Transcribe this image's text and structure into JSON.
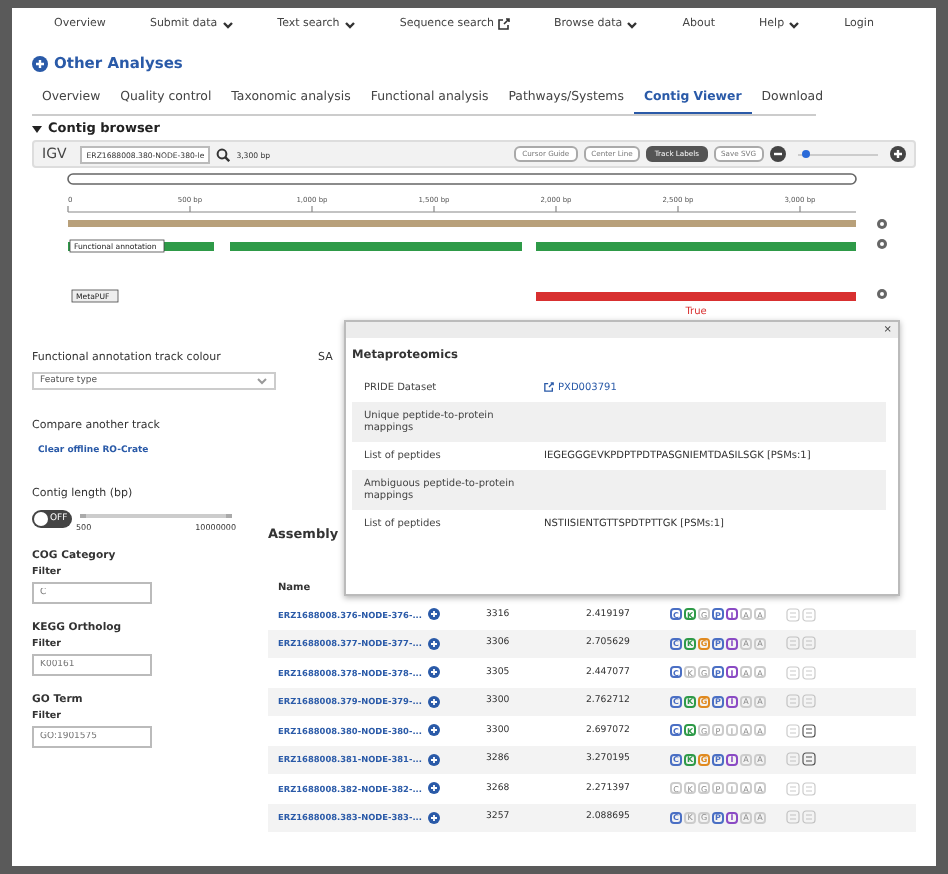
{
  "nav": [
    {
      "label": "Overview",
      "dropdown": false,
      "external": false
    },
    {
      "label": "Submit data",
      "dropdown": true,
      "external": false
    },
    {
      "label": "Text search",
      "dropdown": true,
      "external": false
    },
    {
      "label": "Sequence search",
      "dropdown": false,
      "external": true
    },
    {
      "label": "Browse data",
      "dropdown": true,
      "external": false
    },
    {
      "label": "About",
      "dropdown": false,
      "external": false
    },
    {
      "label": "Help",
      "dropdown": true,
      "external": false
    },
    {
      "label": "Login",
      "dropdown": false,
      "external": false
    }
  ],
  "section_title": "Other Analyses",
  "tabs": [
    {
      "label": "Overview",
      "selected": false
    },
    {
      "label": "Quality control",
      "selected": false
    },
    {
      "label": "Taxonomic analysis",
      "selected": false
    },
    {
      "label": "Functional analysis",
      "selected": false
    },
    {
      "label": "Pathways/Systems",
      "selected": false
    },
    {
      "label": "Contig Viewer",
      "selected": true
    },
    {
      "label": "Download",
      "selected": false
    }
  ],
  "contig_browser": {
    "title": "Contig browser",
    "expanded": true,
    "igv": {
      "logo": "IGV",
      "locus": "ERZ1688008.380-NODE-380-le",
      "size": "3,300 bp",
      "buttons": [
        {
          "label": "Cursor Guide",
          "selected": false
        },
        {
          "label": "Center Line",
          "selected": false
        },
        {
          "label": "Track Labels",
          "selected": true
        },
        {
          "label": "Save SVG",
          "selected": false
        }
      ],
      "zoom": {
        "level": 0.05
      }
    },
    "ruler": [
      "0",
      "500 bp",
      "1,000 bp",
      "1,500 bp",
      "2,000 bp",
      "2,500 bp",
      "3,000 bp"
    ],
    "tracks": [
      {
        "kind": "sequence"
      },
      {
        "kind": "features",
        "label": "Functional annotation",
        "color": "#2e9a48"
      },
      {
        "kind": "features",
        "label": "MetaPUF",
        "color": "#d83030",
        "feature_label": "True"
      }
    ]
  },
  "track_colour": {
    "label": "Functional annotation track colour",
    "value": "Feature type"
  },
  "sa_label": "SA",
  "compare": {
    "label": "Compare another track",
    "link": "Clear offline RO-Crate"
  },
  "contig_length": {
    "label": "Contig length (bp)",
    "toggle": {
      "on": false,
      "label": "OFF"
    },
    "level": 1,
    "min": "500",
    "max": "10000000"
  },
  "filters": [
    {
      "heading": "COG Category",
      "label": "Filter",
      "placeholder": "C"
    },
    {
      "heading": "KEGG Ortholog",
      "label": "Filter",
      "placeholder": "K00161"
    },
    {
      "heading": "GO Term",
      "label": "Filter",
      "placeholder": "GO:1901575"
    }
  ],
  "assembly": {
    "title": "Assembly",
    "columns": [
      "Name"
    ],
    "rows": [
      {
        "name": "ERZ1688008.376-NODE-376-...",
        "length": "3316",
        "coverage": "2.419197",
        "badges": [
          {
            "letter": "C",
            "on": true
          },
          {
            "letter": "K",
            "on": true
          },
          {
            "letter": "G",
            "on": false
          },
          {
            "letter": "P",
            "on": true
          },
          {
            "letter": "I",
            "on": true
          },
          {
            "letter": "A",
            "on": false
          },
          {
            "letter": "A",
            "on": false
          }
        ],
        "extras": [
          false,
          false
        ]
      },
      {
        "name": "ERZ1688008.377-NODE-377-...",
        "length": "3306",
        "coverage": "2.705629",
        "badges": [
          {
            "letter": "C",
            "on": true
          },
          {
            "letter": "K",
            "on": true
          },
          {
            "letter": "G",
            "on": true
          },
          {
            "letter": "P",
            "on": true
          },
          {
            "letter": "I",
            "on": true
          },
          {
            "letter": "A",
            "on": false
          },
          {
            "letter": "A",
            "on": false
          }
        ],
        "extras": [
          false,
          false
        ]
      },
      {
        "name": "ERZ1688008.378-NODE-378-...",
        "length": "3305",
        "coverage": "2.447077",
        "badges": [
          {
            "letter": "C",
            "on": true
          },
          {
            "letter": "K",
            "on": false
          },
          {
            "letter": "G",
            "on": false
          },
          {
            "letter": "P",
            "on": true
          },
          {
            "letter": "I",
            "on": true
          },
          {
            "letter": "A",
            "on": false
          },
          {
            "letter": "A",
            "on": false
          }
        ],
        "extras": [
          false,
          false
        ]
      },
      {
        "name": "ERZ1688008.379-NODE-379-...",
        "length": "3300",
        "coverage": "2.762712",
        "badges": [
          {
            "letter": "C",
            "on": true
          },
          {
            "letter": "K",
            "on": true
          },
          {
            "letter": "G",
            "on": true
          },
          {
            "letter": "P",
            "on": true
          },
          {
            "letter": "I",
            "on": true
          },
          {
            "letter": "A",
            "on": false
          },
          {
            "letter": "A",
            "on": false
          }
        ],
        "extras": [
          false,
          false
        ]
      },
      {
        "name": "ERZ1688008.380-NODE-380-...",
        "length": "3300",
        "coverage": "2.697072",
        "badges": [
          {
            "letter": "C",
            "on": true
          },
          {
            "letter": "K",
            "on": true
          },
          {
            "letter": "G",
            "on": false
          },
          {
            "letter": "P",
            "on": false
          },
          {
            "letter": "I",
            "on": false
          },
          {
            "letter": "A",
            "on": false
          },
          {
            "letter": "A",
            "on": false
          }
        ],
        "extras": [
          false,
          true
        ]
      },
      {
        "name": "ERZ1688008.381-NODE-381-...",
        "length": "3286",
        "coverage": "3.270195",
        "badges": [
          {
            "letter": "C",
            "on": true
          },
          {
            "letter": "K",
            "on": true
          },
          {
            "letter": "G",
            "on": true
          },
          {
            "letter": "P",
            "on": true
          },
          {
            "letter": "I",
            "on": true
          },
          {
            "letter": "A",
            "on": false
          },
          {
            "letter": "A",
            "on": false
          }
        ],
        "extras": [
          false,
          true
        ]
      },
      {
        "name": "ERZ1688008.382-NODE-382-...",
        "length": "3268",
        "coverage": "2.271397",
        "badges": [
          {
            "letter": "C",
            "on": false
          },
          {
            "letter": "K",
            "on": false
          },
          {
            "letter": "G",
            "on": false
          },
          {
            "letter": "P",
            "on": false
          },
          {
            "letter": "I",
            "on": false
          },
          {
            "letter": "A",
            "on": false
          },
          {
            "letter": "A",
            "on": false
          }
        ],
        "extras": [
          false,
          false
        ]
      },
      {
        "name": "ERZ1688008.383-NODE-383-...",
        "length": "3257",
        "coverage": "2.088695",
        "badges": [
          {
            "letter": "C",
            "on": true
          },
          {
            "letter": "K",
            "on": false
          },
          {
            "letter": "G",
            "on": false
          },
          {
            "letter": "P",
            "on": true
          },
          {
            "letter": "I",
            "on": true
          },
          {
            "letter": "A",
            "on": false
          },
          {
            "letter": "A",
            "on": false
          }
        ],
        "extras": [
          false,
          false
        ]
      }
    ]
  },
  "popup": {
    "close": "×",
    "title": "Metaproteomics",
    "rows": [
      {
        "kind": "pair",
        "label": "PRIDE Dataset",
        "value": "PXD003791",
        "link": true
      },
      {
        "kind": "section",
        "label": "Unique peptide-to-protein mappings"
      },
      {
        "kind": "pair",
        "label": "List of peptides",
        "value": "IEGEGGGEVKPDPTPDTPASGNIEMTDASILSGK [PSMs:1]",
        "link": false
      },
      {
        "kind": "section",
        "label": "Ambiguous peptide-to-protein mappings"
      },
      {
        "kind": "pair",
        "label": "List of peptides",
        "value": "NSTIISIENTGTTSPDTPTTGK [PSMs:1]",
        "link": false
      }
    ]
  }
}
